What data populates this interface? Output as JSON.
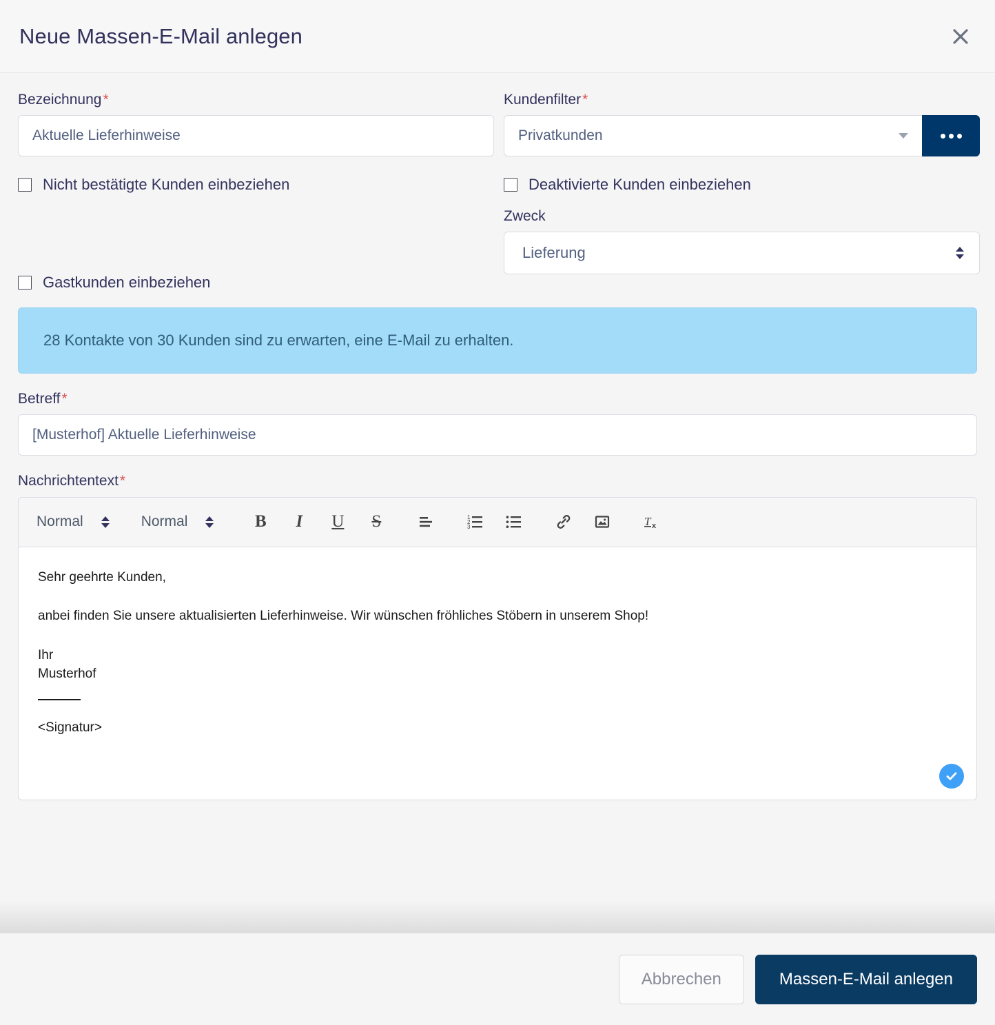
{
  "header": {
    "title": "Neue Massen-E-Mail anlegen",
    "close_icon": "close-icon"
  },
  "form": {
    "bezeichnung": {
      "label": "Bezeichnung",
      "required_mark": "*",
      "value": "Aktuelle Lieferhinweise"
    },
    "kundenfilter": {
      "label": "Kundenfilter",
      "required_mark": "*",
      "value": "Privatkunden",
      "more_button_icon": "ellipsis-icon"
    },
    "checkboxes": [
      {
        "label": "Nicht bestätigte Kunden einbeziehen",
        "checked": false
      },
      {
        "label": "Deaktivierte Kunden einbeziehen",
        "checked": false
      },
      {
        "label": "Gastkunden einbeziehen",
        "checked": false
      }
    ],
    "zweck": {
      "label": "Zweck",
      "value": "Lieferung"
    },
    "info_alert": {
      "text": "28 Kontakte von 30 Kunden sind zu erwarten, eine E-Mail zu erhalten.",
      "background": "#a3dcf8",
      "text_color": "#2f5d78"
    },
    "betreff": {
      "label": "Betreff",
      "required_mark": "*",
      "value": "[Musterhof] Aktuelle Lieferhinweise"
    },
    "nachrichtentext": {
      "label": "Nachrichtentext",
      "required_mark": "*",
      "toolbar": {
        "header_select": "Normal",
        "font_select": "Normal",
        "buttons": [
          {
            "name": "bold-icon",
            "glyph": "B"
          },
          {
            "name": "italic-icon",
            "glyph": "I"
          },
          {
            "name": "underline-icon",
            "glyph": "U"
          },
          {
            "name": "strikethrough-icon",
            "glyph": "S"
          },
          {
            "name": "align-left-icon",
            "glyph": ""
          },
          {
            "name": "ordered-list-icon",
            "glyph": ""
          },
          {
            "name": "bullet-list-icon",
            "glyph": ""
          },
          {
            "name": "link-icon",
            "glyph": ""
          },
          {
            "name": "image-icon",
            "glyph": ""
          },
          {
            "name": "clear-format-icon",
            "glyph": ""
          }
        ]
      },
      "body": {
        "line1": "Sehr geehrte Kunden,",
        "line2": "anbei finden Sie unsere aktualisierten Lieferhinweise. Wir wünschen fröhliches Stöbern in unserem Shop!",
        "line3": "Ihr",
        "line4": "Musterhof",
        "line5": "<Signatur>"
      },
      "status_badge_icon": "checkmark-icon"
    }
  },
  "footer": {
    "cancel_label": "Abbrechen",
    "submit_label": "Massen-E-Mail anlegen",
    "primary_color": "#0a3b63"
  }
}
